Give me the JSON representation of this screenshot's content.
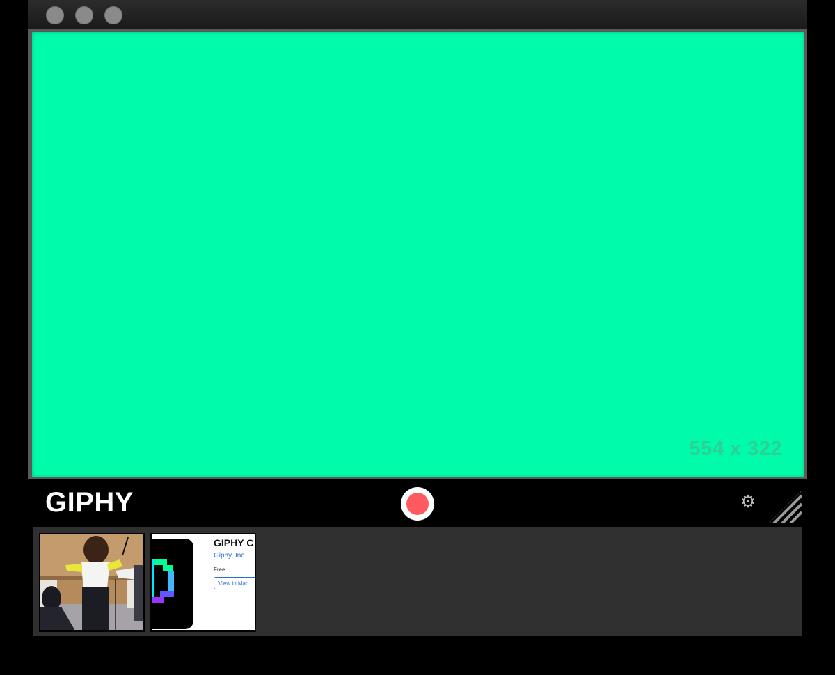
{
  "window": {
    "titlebar_buttons": [
      "close",
      "minimize",
      "zoom"
    ],
    "capture_color": "#00fbab"
  },
  "capture": {
    "dimensions_text": "554 x 322"
  },
  "controls": {
    "logo_text": "GIPHY",
    "record_color": "#ff5a5f",
    "settings_icon": "gear-icon",
    "resize_icon": "resize-grip-icon"
  },
  "tray": {
    "items": [
      {
        "type": "video-thumbnail"
      },
      {
        "type": "screenshot-thumbnail",
        "title": "GIPHY C",
        "developer": "Giphy, Inc.",
        "price": "Free",
        "button": "View in Mac"
      }
    ]
  }
}
